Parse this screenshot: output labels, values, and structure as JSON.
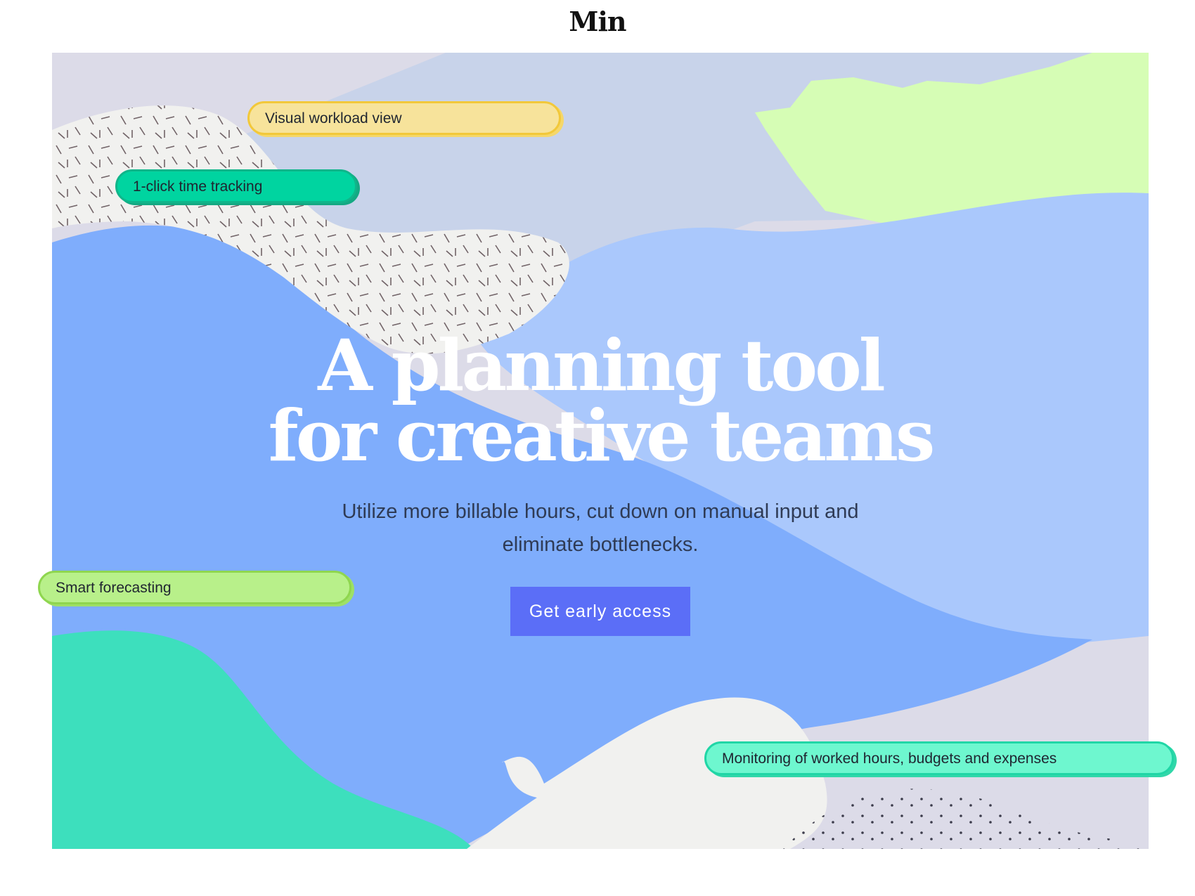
{
  "brand": {
    "logo_text": "Min"
  },
  "hero": {
    "headline_line1": "A planning tool",
    "headline_line2": "for creative teams",
    "subtitle": "Utilize more billable hours, cut down on manual input and eliminate bottlenecks.",
    "cta_label": "Get early access"
  },
  "features": [
    {
      "label": "Visual workload view",
      "color": "#f7e39b"
    },
    {
      "label": "1-click time tracking",
      "color": "#00d4a0"
    },
    {
      "label": "Smart forecasting",
      "color": "#b8f08a"
    },
    {
      "label": "Monitoring of worked hours, budgets and expenses",
      "color": "#6ef7cf"
    }
  ],
  "colors": {
    "cta": "#5b6ef7",
    "background_base": "#dcdbe8",
    "blue_wave": "#7fadfc",
    "light_blue_wave": "#aac8fc",
    "lime_shape": "#d6fdb5",
    "teal_shape": "#3ddfbd",
    "pattern_shape": "#f1f1ef"
  }
}
